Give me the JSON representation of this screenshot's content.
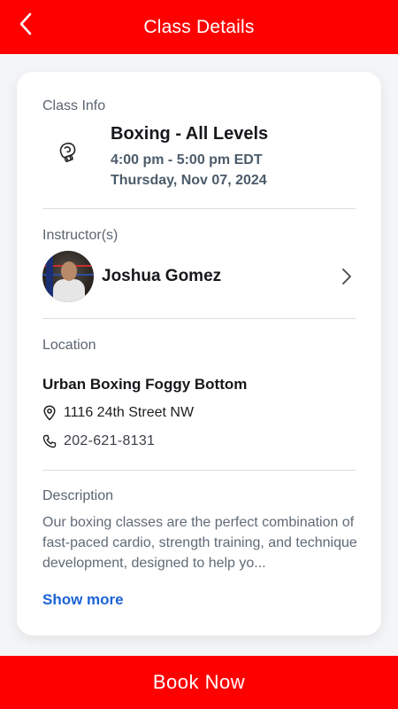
{
  "header": {
    "title": "Class Details",
    "back_icon": "chevron-left-icon"
  },
  "class_info": {
    "label": "Class Info",
    "icon": "boxing-glove-icon",
    "name": "Boxing - All Levels",
    "time": "4:00 pm - 5:00 pm EDT",
    "date": "Thursday, Nov 07, 2024"
  },
  "instructor": {
    "label": "Instructor(s)",
    "name": "Joshua Gomez"
  },
  "location": {
    "label": "Location",
    "name": "Urban Boxing Foggy Bottom",
    "address": "1116 24th Street NW",
    "phone": "202-621-8131"
  },
  "description": {
    "label": "Description",
    "text": "Our boxing classes are the perfect combination of fast-paced cardio, strength training, and technique development, designed to help yo...",
    "show_more": "Show more"
  },
  "footer": {
    "book_label": "Book Now"
  },
  "colors": {
    "brand": "#fe0000",
    "link": "#1b63d6"
  }
}
